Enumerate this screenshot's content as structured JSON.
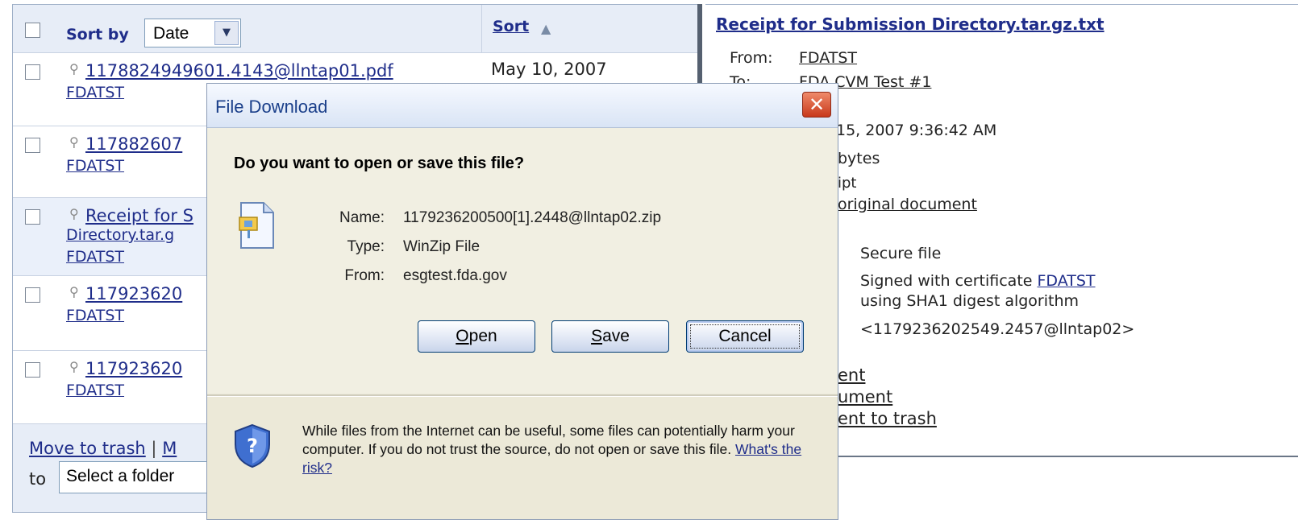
{
  "list": {
    "sort_by_label": "Sort by",
    "sort_select_value": "Date",
    "sort_link": "Sort",
    "rows": [
      {
        "subject": "1178824949601.4143@llntap01.pdf",
        "from": "FDATST",
        "date": "May 10, 2007"
      },
      {
        "subject": "117882607",
        "from": "FDATST"
      },
      {
        "subject_line1": "Receipt for S",
        "subject_line2": "Directory.tar.g",
        "from": "FDATST"
      },
      {
        "subject": "117923620",
        "from": "FDATST"
      },
      {
        "subject": "117923620",
        "from": "FDATST"
      }
    ],
    "footer": {
      "move_to_trash": "Move to trash",
      "sep": "|",
      "move_partial": "M",
      "to_label": "to",
      "folder_select_value": "Select a folder"
    }
  },
  "preview": {
    "title": "Receipt for Submission Directory.tar.gz.txt",
    "from_label": "From:",
    "from_value": "FDATST",
    "to_label": "To:",
    "to_value": "FDA CVM Test #1",
    "date_partial": "15, 2007 9:36:42 AM",
    "size_partial": "bytes",
    "type_partial": "ipt",
    "view_original_partial": "original document",
    "secure_file": "Secure file",
    "signed_text": "Signed with certificate",
    "signed_cert": "FDATST",
    "digest_text": "using SHA1 digest algorithm",
    "message_id": "<1179236202549.2457@llntap02>",
    "action1": "ent",
    "action2": "ument",
    "action3": "ent to trash"
  },
  "dialog": {
    "title": "File Download",
    "question": "Do you want to open or save this file?",
    "name_label": "Name:",
    "name_value": "1179236200500[1].2448@llntap02.zip",
    "type_label": "Type:",
    "type_value": "WinZip File",
    "from_label": "From:",
    "from_value": "esgtest.fda.gov",
    "open_first": "O",
    "open_rest": "pen",
    "save_first": "S",
    "save_rest": "ave",
    "cancel": "Cancel",
    "warning_text": "While files from the Internet can be useful, some files can potentially harm your computer. If you do not trust the source, do not open or save this file.",
    "risk_link": "What's the risk?"
  },
  "colors": {
    "link": "#1f2d8a",
    "dialog_bg": "#ece9d8",
    "close_button": "#c8391b",
    "header_bg": "#e7edf7"
  },
  "icons": [
    "checkbox",
    "magnifier-icon",
    "dropdown-arrow-icon",
    "sort-up-icon",
    "close-icon",
    "zip-file-icon",
    "security-shield-icon"
  ]
}
